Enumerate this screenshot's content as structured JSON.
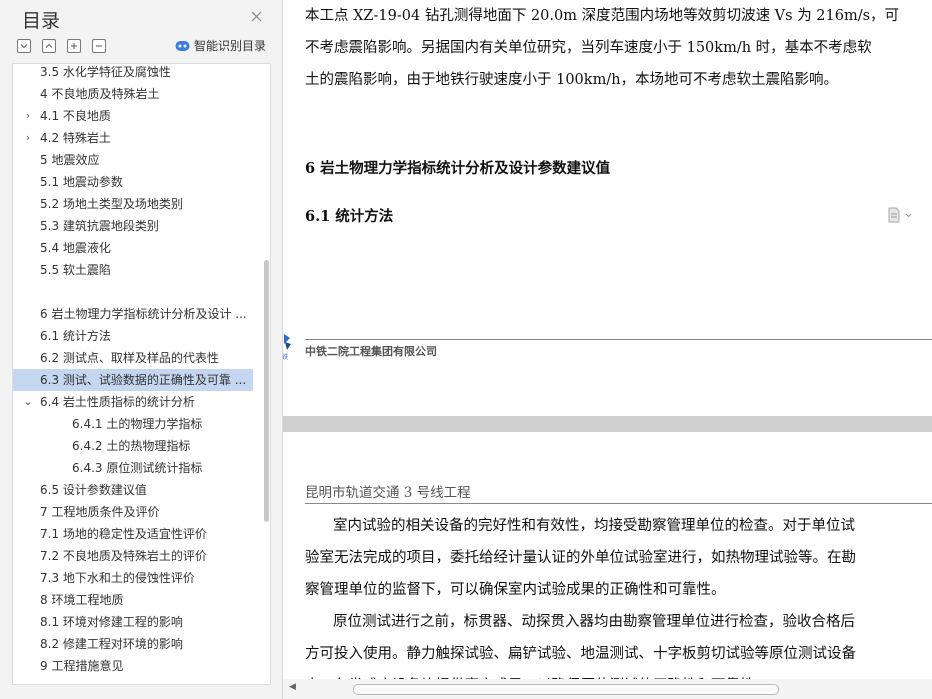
{
  "sidebar": {
    "title": "目录",
    "ai_label": "智能识别目录",
    "toc": [
      {
        "label": "3.5 水化学特征及腐蚀性",
        "level": 0,
        "arrow": ""
      },
      {
        "label": "4 不良地质及特殊岩土",
        "level": 0,
        "arrow": ""
      },
      {
        "label": "4.1 不良地质",
        "level": 0,
        "arrow": "›"
      },
      {
        "label": "4.2 特殊岩土",
        "level": 0,
        "arrow": "›"
      },
      {
        "label": "5 地震效应",
        "level": 0,
        "arrow": ""
      },
      {
        "label": "5.1 地震动参数",
        "level": 0,
        "arrow": ""
      },
      {
        "label": "5.2 场地土类型及场地类别",
        "level": 0,
        "arrow": ""
      },
      {
        "label": "5.3 建筑抗震地段类别",
        "level": 0,
        "arrow": ""
      },
      {
        "label": "5.4 地震液化",
        "level": 0,
        "arrow": ""
      },
      {
        "label": "5.5 软土震陷",
        "level": 0,
        "arrow": ""
      },
      {
        "label": "",
        "level": 0,
        "arrow": ""
      },
      {
        "label": "6 岩土物理力学指标统计分析及设计 ...",
        "level": 0,
        "arrow": ""
      },
      {
        "label": "6.1 统计方法",
        "level": 0,
        "arrow": ""
      },
      {
        "label": "6.2 测试点、取样及样品的代表性",
        "level": 0,
        "arrow": ""
      },
      {
        "label": "6.3 测试、试验数据的正确性及可靠 ...",
        "level": 0,
        "arrow": "",
        "selected": true
      },
      {
        "label": "6.4  岩土性质指标的统计分析",
        "level": 0,
        "arrow": "⌄"
      },
      {
        "label": "6.4.1 土的物理力学指标",
        "level": 1,
        "arrow": ""
      },
      {
        "label": "6.4.2 土的热物理指标",
        "level": 1,
        "arrow": ""
      },
      {
        "label": "6.4.3 原位测试统计指标",
        "level": 1,
        "arrow": ""
      },
      {
        "label": "6.5 设计参数建议值",
        "level": 0,
        "arrow": ""
      },
      {
        "label": "7 工程地质条件及评价",
        "level": 0,
        "arrow": ""
      },
      {
        "label": "7.1 场地的稳定性及适宜性评价",
        "level": 0,
        "arrow": ""
      },
      {
        "label": "7.2 不良地质及特殊岩土的评价",
        "level": 0,
        "arrow": ""
      },
      {
        "label": "7.3 地下水和土的侵蚀性评价",
        "level": 0,
        "arrow": ""
      },
      {
        "label": "8 环境工程地质",
        "level": 0,
        "arrow": ""
      },
      {
        "label": "8.1 环境对修建工程的影响",
        "level": 0,
        "arrow": ""
      },
      {
        "label": "8.2 修建工程对环境的影响",
        "level": 0,
        "arrow": ""
      },
      {
        "label": "9 工程措施意见",
        "level": 0,
        "arrow": ""
      }
    ]
  },
  "document": {
    "page1_lines": [
      "本工点 XZ-19-04 钻孔测得地面下 20.0m 深度范围内场地等效剪切波速 Vs 为 216m/s，可",
      "不考虑震陷影响。另据国内有关单位研究，当列车速度小于 150km/h 时，基本不考虑软",
      "土的震陷影响，由于地铁行驶速度小于 100km/h，本场地可不考虑软土震陷影响。"
    ],
    "heading_6": "6 岩土物理力学指标统计分析及设计参数建议值",
    "heading_6_1": "6.1 统计方法",
    "footer_company": "中铁二院工程集团有限公司",
    "header_project": "昆明市轨道交通 3 号线工程",
    "page2_lines": [
      "室内试验的相关设备的完好性和有效性，均接受勘察管理单位的检查。对于单位试",
      "验室无法完成的项目，委托给经计量认证的外单位试验室进行，如热物理试验等。在勘",
      "察管理单位的监督下，可以确保室内试验成果的正确性和可靠性。",
      "原位测试进行之前，标贯器、动探贯入器均由勘察管理单位进行检查，验收合格后",
      "方可投入使用。静力触探试验、扁铲试验、地温测试、十字板剪切试验等原位测试设备",
      "中，各类感应设备均提供率定成果，以确保原位测试的正确性和可靠性。"
    ]
  }
}
